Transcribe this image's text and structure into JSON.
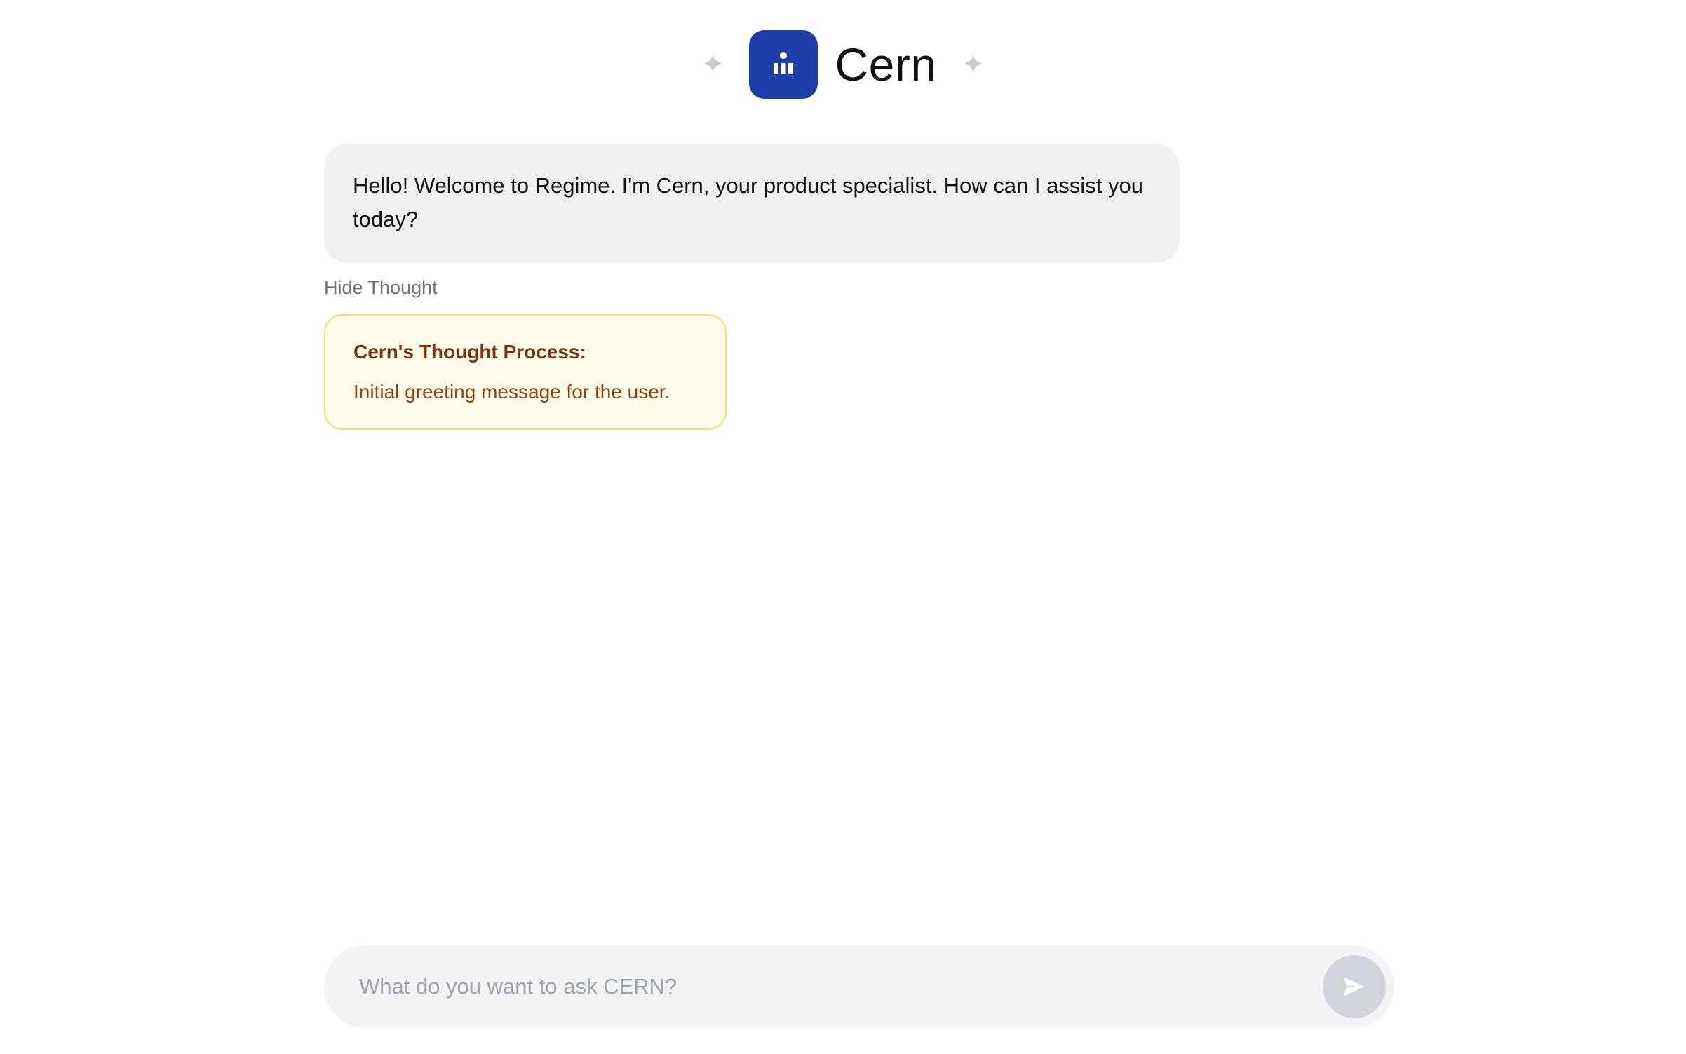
{
  "header": {
    "brand": "Cern",
    "logo_color": "#1e3fa8",
    "left_icon": "sparkle-icon",
    "right_icon": "sparkle-icon",
    "sparkle_glyph": "✦"
  },
  "messages": [
    {
      "role": "assistant",
      "text": "Hello! Welcome to Regime. I'm Cern, your product specialist. How can I assist you today?"
    }
  ],
  "thought_toggle": {
    "label": "Hide Thought"
  },
  "thought": {
    "title": "Cern's Thought Process:",
    "body": "Initial greeting message for the user.",
    "background": "#fefae8",
    "border": "#f5dc7a"
  },
  "composer": {
    "placeholder": "What do you want to ask CERN?",
    "value": "",
    "send_icon": "send-icon"
  }
}
